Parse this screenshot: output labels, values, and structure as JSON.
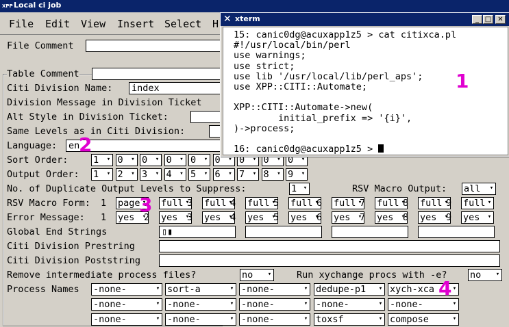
{
  "main_window": {
    "title": "Local ci job",
    "icon_label": "XPP",
    "menu": [
      "File",
      "Edit",
      "View",
      "Insert",
      "Select",
      "H"
    ],
    "file_comment_label": "File Comment",
    "table_comment_label": "Table Comment",
    "citi_division_name_label": "Citi Division Name:",
    "citi_division_name_value": "index",
    "division_message_label": "Division Message in Division Ticket",
    "alt_style_label": "Alt Style in Division Ticket:",
    "same_levels_label": "Same Levels as in Citi Division:",
    "language_label": "Language:",
    "language_value": "en",
    "sort_order_label": "Sort Order:",
    "sort_order_values": [
      "1",
      "0",
      "0",
      "0",
      "0",
      "0",
      "0",
      "0",
      "0"
    ],
    "output_order_label": "Output Order:",
    "output_order_values": [
      "1",
      "2",
      "3",
      "4",
      "5",
      "6",
      "7",
      "8",
      "9"
    ],
    "dup_levels_label": "No. of Duplicate Output Levels to Suppress:",
    "dup_levels_value": "1",
    "rsv_macro_output_label": "RSV Macro Output:",
    "rsv_macro_output_value": "all",
    "rsv_macro_form_label": "RSV Macro Form:",
    "rsv_macro_form": [
      {
        "num": "1",
        "value": "page"
      },
      {
        "num": "2",
        "value": "full"
      },
      {
        "num": "3",
        "value": "full"
      },
      {
        "num": "4",
        "value": "full"
      },
      {
        "num": "5",
        "value": "full"
      },
      {
        "num": "6",
        "value": "full"
      },
      {
        "num": "7",
        "value": "full"
      },
      {
        "num": "8",
        "value": "full"
      },
      {
        "num": "9",
        "value": "full"
      }
    ],
    "error_message_label": "Error Message:",
    "error_message": [
      {
        "num": "1",
        "value": "yes"
      },
      {
        "num": "2",
        "value": "yes"
      },
      {
        "num": "3",
        "value": "yes"
      },
      {
        "num": "4",
        "value": "yes"
      },
      {
        "num": "5",
        "value": "yes"
      },
      {
        "num": "6",
        "value": "yes"
      },
      {
        "num": "7",
        "value": "yes"
      },
      {
        "num": "8",
        "value": "yes"
      },
      {
        "num": "9",
        "value": "yes"
      }
    ],
    "global_end_strings_label": "Global End Strings",
    "global_end_strings_value": "▯▮",
    "prestring_label": "Citi Division Prestring",
    "poststring_label": "Citi Division Poststring",
    "remove_intermediate_label": "Remove intermediate process files?",
    "remove_intermediate_value": "no",
    "run_xychange_label": "Run xychange procs with -e?",
    "run_xychange_value": "no",
    "process_names_label": "Process Names",
    "process_names": [
      [
        "-none-",
        "sort-a",
        "-none-",
        "dedupe-p1",
        "xych-xca"
      ],
      [
        "-none-",
        "-none-",
        "-none-",
        "-none-",
        "-none-"
      ],
      [
        "-none-",
        "-none-",
        "-none-",
        "toxsf",
        "compose"
      ]
    ]
  },
  "xterm": {
    "title": "xterm",
    "lines": [
      "15: canic0dg@acuxapp1z5 > cat citixca.pl",
      "#!/usr/local/bin/perl",
      "use warnings;",
      "use strict;",
      "use lib '/usr/local/lib/perl_aps';",
      "use XPP::CITI::Automate;",
      "",
      "XPP::CITI::Automate->new(",
      "        initial_prefix => '{i}',",
      ")->process;",
      "",
      "16: canic0dg@acuxapp1z5 > "
    ]
  },
  "annotations": [
    "1",
    "2",
    "3",
    "4"
  ],
  "colors": {
    "title_bar": "#0a246a",
    "annotation": "#e000d0",
    "window_bg": "#d4d0c8"
  }
}
